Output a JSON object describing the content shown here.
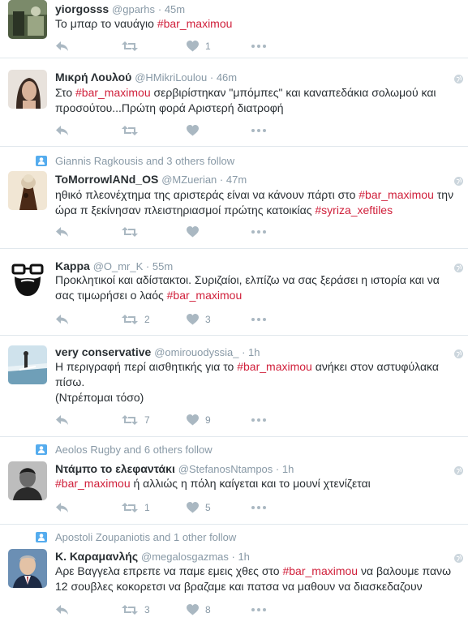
{
  "tweets": [
    {
      "name": "yiorgosss",
      "handle": "@gparhs",
      "time": "45m",
      "text_parts": [
        "Το μπαρ το ναυάγιο ",
        "#bar_maximou"
      ],
      "retweets": "",
      "likes": "1",
      "show_likes": true
    },
    {
      "name": "Μικρή Λουλού",
      "handle": "@HMikriLoulou",
      "time": "46m",
      "text_parts": [
        "Στο ",
        "#bar_maximou",
        " σερβιρίστηκαν \"μπόμπες\" και καναπεδάκια σολωμού και προσούτου...Πρώτη φορά Αριστερή διατροφή"
      ],
      "retweets": "",
      "likes": ""
    },
    {
      "context": "Giannis Ragkousis and 3 others follow",
      "name": "ToMorrowlANd_OS",
      "handle": "@MZuerian",
      "time": "47m",
      "text_parts": [
        "ηθικό πλεονέχτημα της αριστεράς είναι να κάνουν πάρτι στο ",
        "#bar_maximou",
        " την ώρα π ξεκίνησαν πλειστηριασμοί πρώτης κατοικίας ",
        "#syriza_xeftiles"
      ],
      "retweets": "",
      "likes": ""
    },
    {
      "name": "Kappa",
      "handle": "@O_mr_K",
      "time": "55m",
      "text_parts": [
        "Προκλητικοί και αδίστακτοι. Συριζαίοι, ελπίζω να σας ξεράσει η ιστορία και να σας τιμωρήσει ο λαός ",
        "#bar_maximou"
      ],
      "retweets": "2",
      "likes": "3"
    },
    {
      "name": "very conservative",
      "handle": "@omirouodyssia_",
      "time": "1h",
      "text_parts": [
        "Η περιγραφή περί αισθητικής για το ",
        "#bar_maximou",
        " ανήκει στον αστυφύλακα πίσω.\n(Ντρέπομαι τόσο)"
      ],
      "retweets": "7",
      "likes": "9"
    },
    {
      "context": "Aeolos Rugby and 6 others follow",
      "name": "Ντάμπο το ελεφαντάκι",
      "handle": "@StefanosNtampos",
      "time": "1h",
      "text_parts": [
        "#bar_maximou",
        " ή αλλιώς η πόλη καίγεται και το μουνί χτενίζεται"
      ],
      "retweets": "1",
      "likes": "5"
    },
    {
      "context": "Apostoli Zoupaniotis and 1 other follow",
      "name": "Κ. Καραμανλής",
      "handle": "@megalosgazmas",
      "time": "1h",
      "text_parts": [
        "Αρε Βαγγελα επρεπε να παμε εμεις χθες στο ",
        "#bar_maximou",
        " να βαλουμε πανω 12 σουβλες κοκορετσι να βραζαμε και πατσα να μαθουν να διασκεδαζουν"
      ],
      "retweets": "3",
      "likes": "8"
    }
  ],
  "colors": {
    "hashtag": "#d0203b",
    "muted": "#8899a6",
    "icon": "#aab8c2",
    "retweet_badge": "#19cf86"
  }
}
